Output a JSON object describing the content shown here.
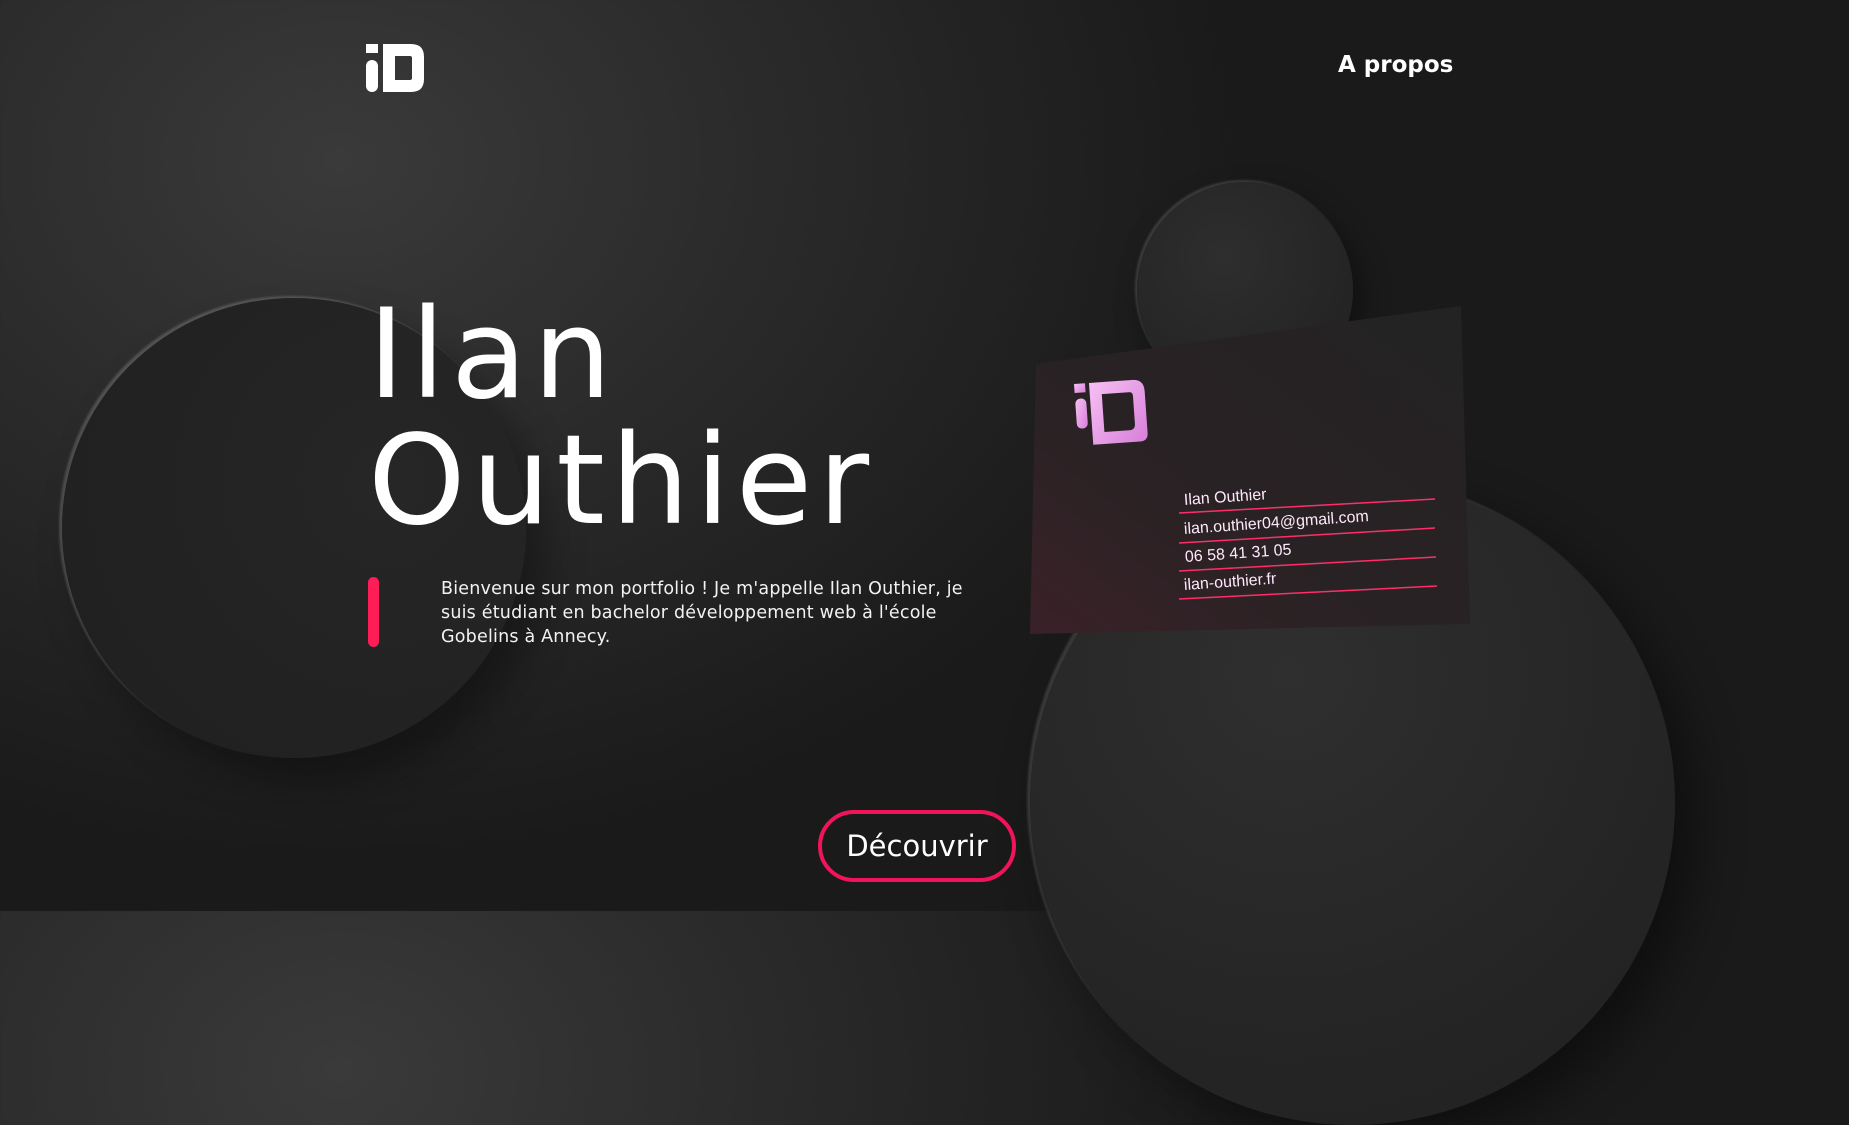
{
  "nav": {
    "about_label": "A propos"
  },
  "hero": {
    "first_name": "Ilan",
    "last_name": "Outhier",
    "intro": "Bienvenue sur mon portfolio ! Je m'appelle Ilan Outhier, je suis étudiant en bachelor développement web à l'école Gobelins à Annecy.",
    "cta_label": "Découvrir"
  },
  "card": {
    "name": "Ilan Outhier",
    "email": "ilan.outhier04@gmail.com",
    "phone": "06 58 41 31 05",
    "website": "ilan-outhier.fr"
  },
  "colors": {
    "accent": "#ff1d58",
    "card_accent": "#e8a0e6",
    "background": "#2b2b2b"
  }
}
